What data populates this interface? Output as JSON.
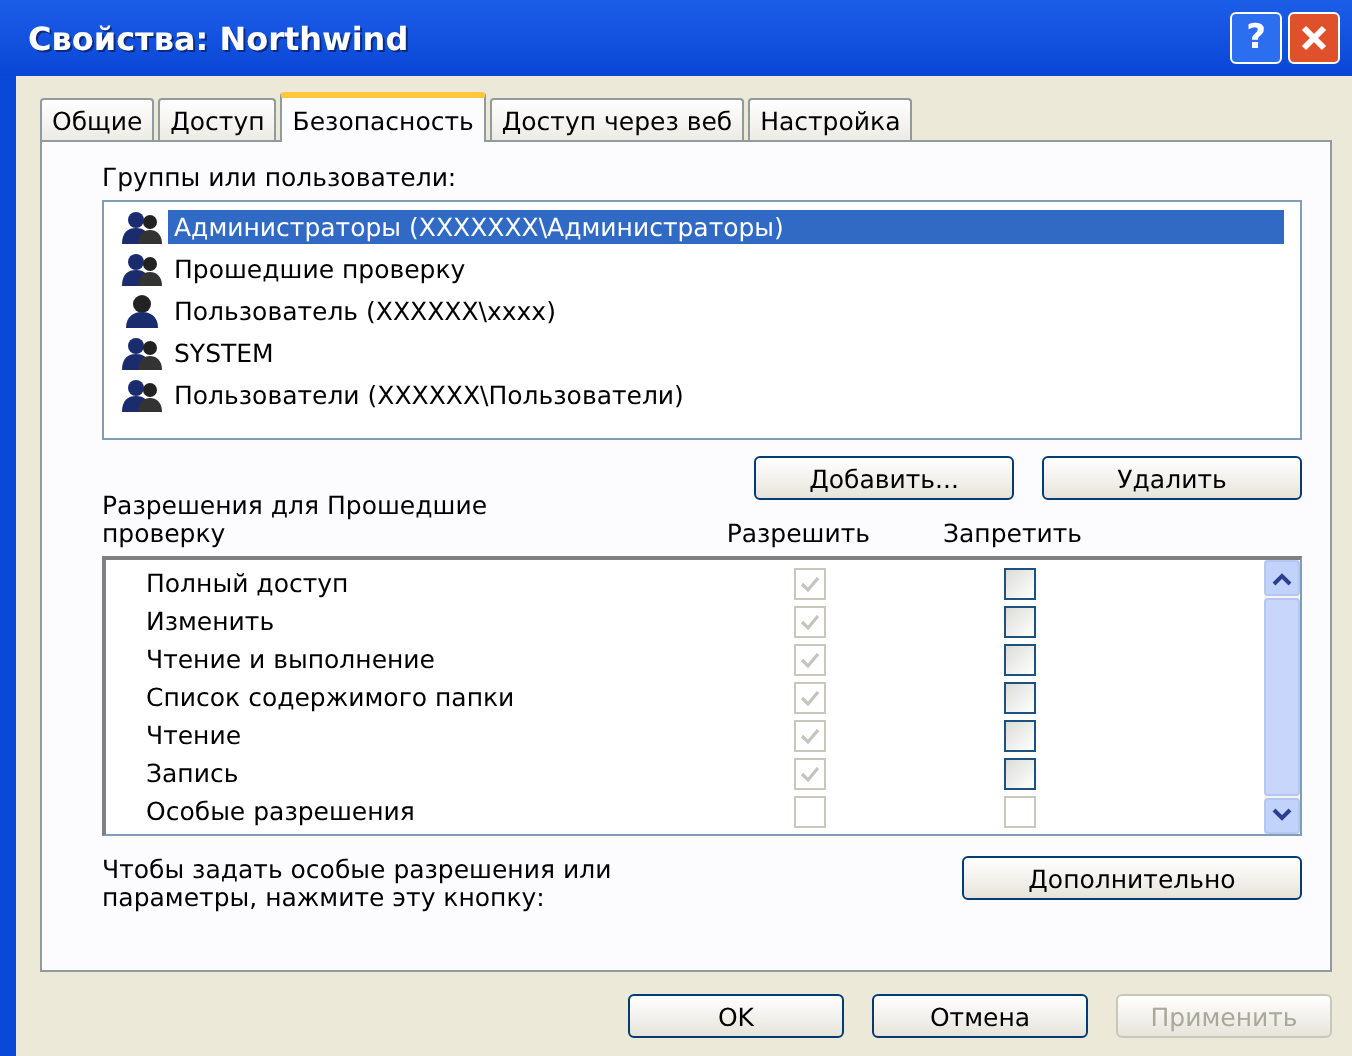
{
  "window": {
    "title": "Свойства: Northwind",
    "help_button": "?"
  },
  "tabs": [
    {
      "label": "Общие",
      "selected": false
    },
    {
      "label": "Доступ",
      "selected": false
    },
    {
      "label": "Безопасность",
      "selected": true
    },
    {
      "label": "Доступ через веб",
      "selected": false
    },
    {
      "label": "Настройка",
      "selected": false
    }
  ],
  "groups_label": "Группы или пользователи:",
  "groups": [
    {
      "name": "Администраторы (XXXXXXX\\Администраторы)",
      "kind": "group",
      "selected": true
    },
    {
      "name": "Прошедшие проверку",
      "kind": "group",
      "selected": false
    },
    {
      "name": "Пользователь (XXXXXX\\xxxx)",
      "kind": "user",
      "selected": false
    },
    {
      "name": "SYSTEM",
      "kind": "group",
      "selected": false
    },
    {
      "name": "Пользователи (XXXXXX\\Пользователи)",
      "kind": "group",
      "selected": false
    }
  ],
  "group_buttons": [
    "Добавить...",
    "Удалить"
  ],
  "permissions_label": "Разрешения для Прошедшие проверку",
  "columns": [
    "Разрешить",
    "Запретить"
  ],
  "permissions": [
    {
      "name": "Полный доступ",
      "allow": {
        "checked": true,
        "disabled": true
      },
      "deny": {
        "checked": false,
        "disabled": false
      }
    },
    {
      "name": "Изменить",
      "allow": {
        "checked": true,
        "disabled": true
      },
      "deny": {
        "checked": false,
        "disabled": false
      }
    },
    {
      "name": "Чтение и выполнение",
      "allow": {
        "checked": true,
        "disabled": true
      },
      "deny": {
        "checked": false,
        "disabled": false
      }
    },
    {
      "name": "Список содержимого папки",
      "allow": {
        "checked": true,
        "disabled": true
      },
      "deny": {
        "checked": false,
        "disabled": false
      }
    },
    {
      "name": "Чтение",
      "allow": {
        "checked": true,
        "disabled": true
      },
      "deny": {
        "checked": false,
        "disabled": false
      }
    },
    {
      "name": "Запись",
      "allow": {
        "checked": true,
        "disabled": true
      },
      "deny": {
        "checked": false,
        "disabled": false
      }
    },
    {
      "name": "Особые разрешения",
      "allow": {
        "checked": false,
        "disabled": true
      },
      "deny": {
        "checked": false,
        "disabled": true
      }
    }
  ],
  "advanced_hint": "Чтобы задать особые разрешения или параметры, нажмите эту кнопку:",
  "advanced_button": "Дополнительно",
  "buttons": [
    {
      "label": "OK",
      "disabled": false
    },
    {
      "label": "Отмена",
      "disabled": false
    },
    {
      "label": "Применить",
      "disabled": true
    }
  ]
}
